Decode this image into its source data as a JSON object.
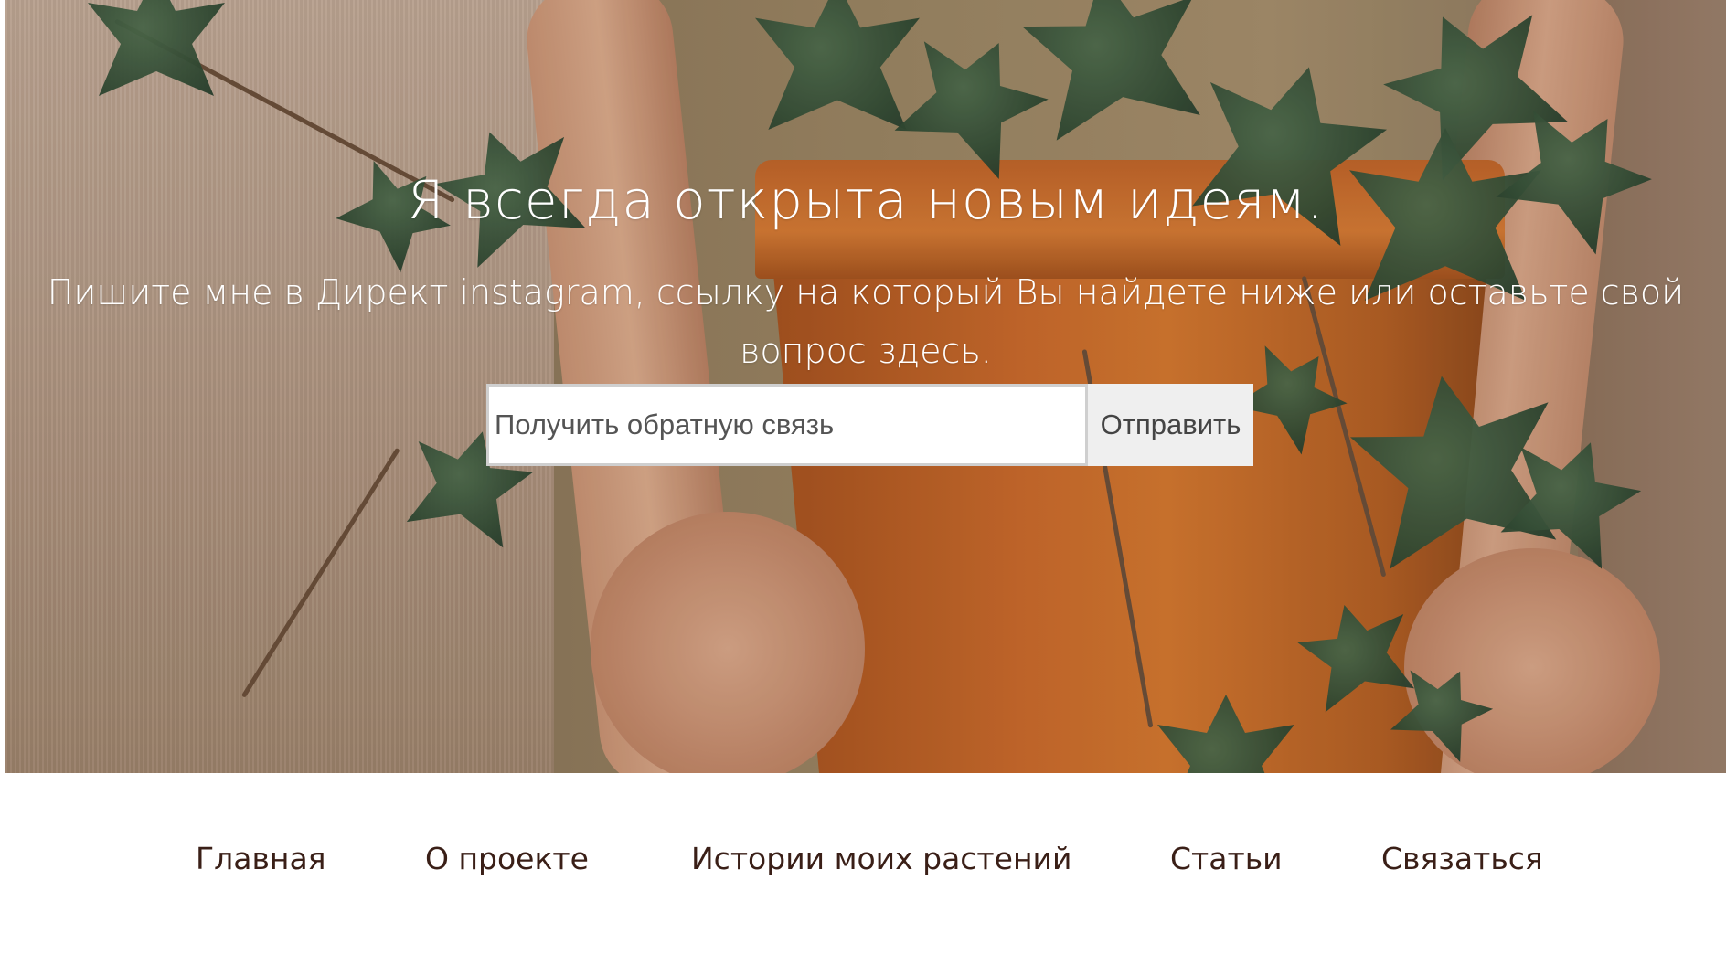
{
  "hero": {
    "title": "Я всегда открыта новым идеям.",
    "subtitle": "Пишите мне в Директ instagram, ссылку на который Вы найдете ниже или оставьте свой вопрос здесь."
  },
  "feedback_form": {
    "placeholder": "Получить обратную связь",
    "submit_label": "Отправить"
  },
  "nav": {
    "items": [
      {
        "label": "Главная"
      },
      {
        "label": "О проекте"
      },
      {
        "label": "Истории моих растений"
      },
      {
        "label": "Статьи"
      },
      {
        "label": "Связаться"
      }
    ]
  },
  "colors": {
    "nav_text": "#3a1f17",
    "hero_text": "#ffffff",
    "button_bg": "#efefef"
  }
}
